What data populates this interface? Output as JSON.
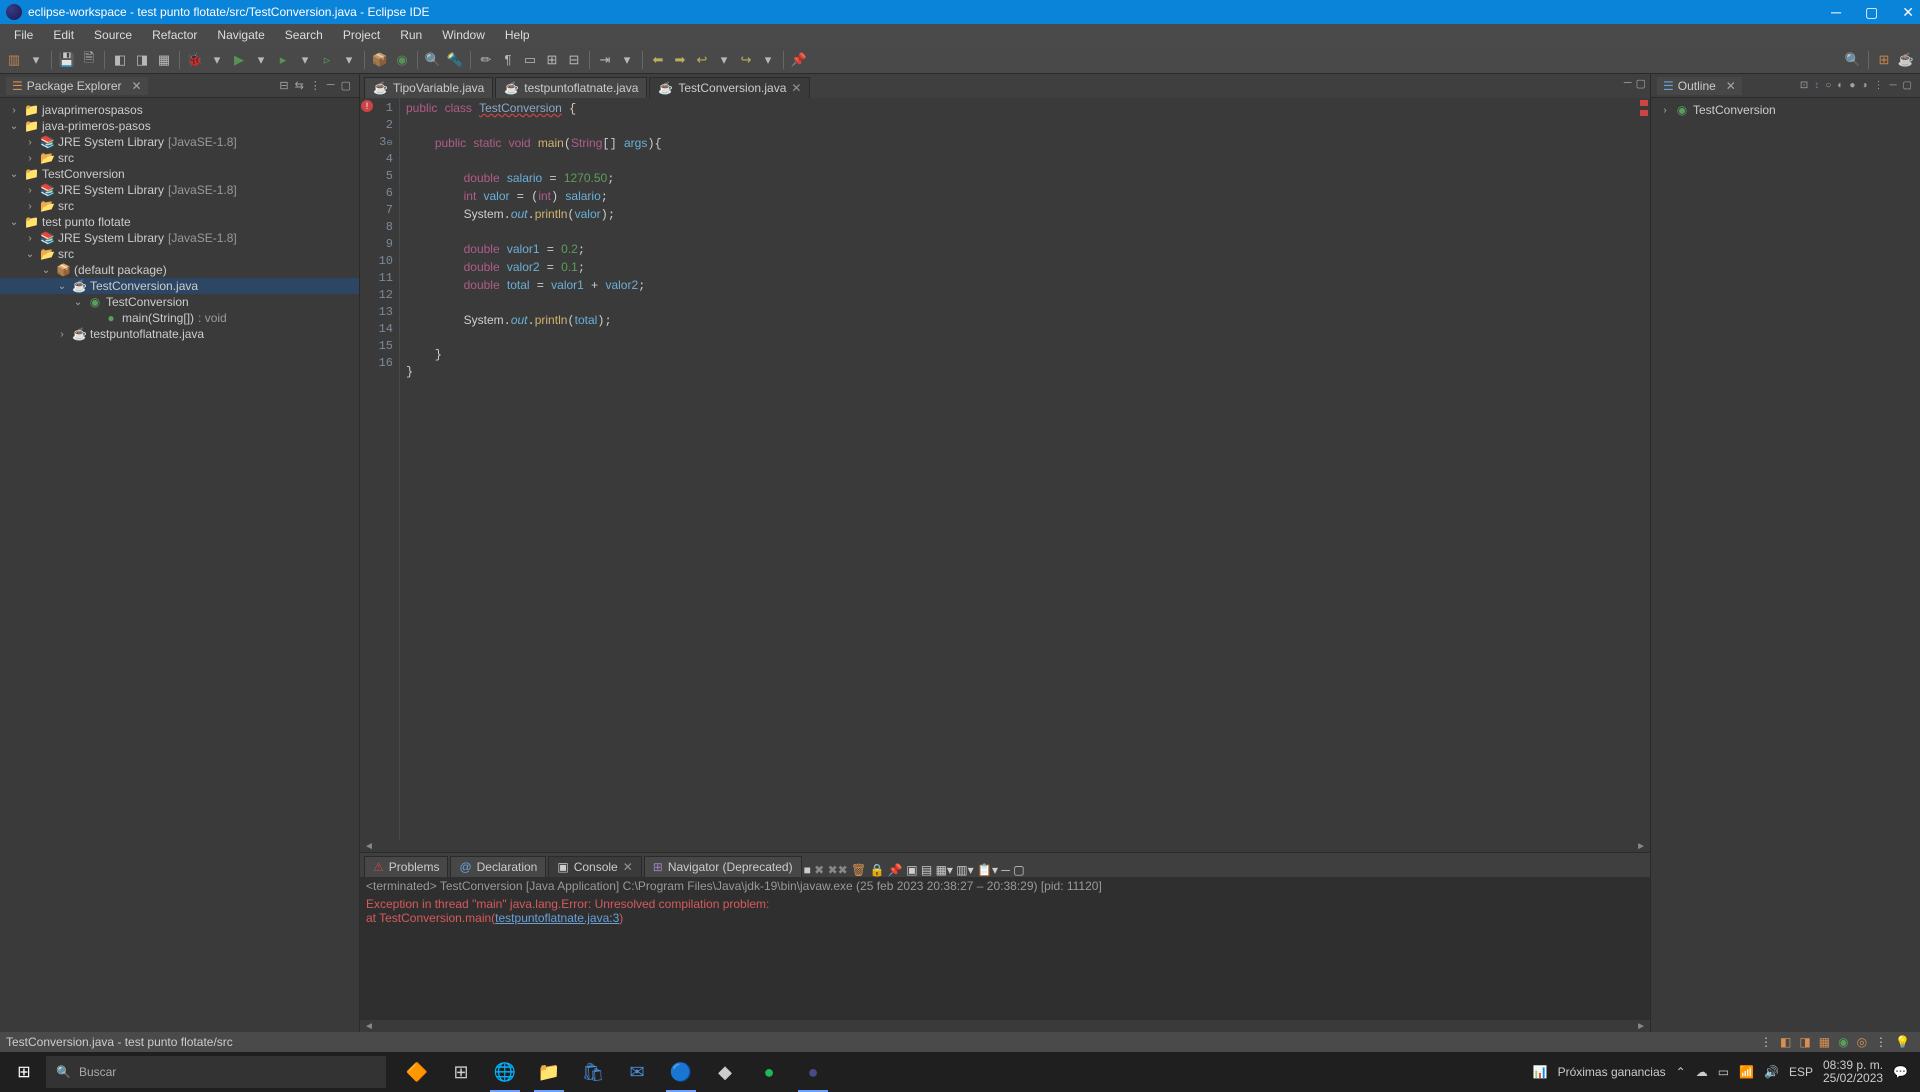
{
  "title": "eclipse-workspace - test punto flotate/src/TestConversion.java - Eclipse IDE",
  "menu": {
    "file": "File",
    "edit": "Edit",
    "source": "Source",
    "refactor": "Refactor",
    "navigate": "Navigate",
    "search": "Search",
    "project": "Project",
    "run": "Run",
    "window": "Window",
    "help": "Help"
  },
  "pkgExplorer": {
    "title": "Package Explorer",
    "projects": {
      "p1": "javaprimerospasos",
      "p2": "java-primeros-pasos",
      "p2_lib": "JRE System Library",
      "lib_ver": "[JavaSE-1.8]",
      "src": "src",
      "p3": "TestConversion",
      "p4": "test punto flotate",
      "defpkg": "(default package)",
      "file1": "TestConversion.java",
      "cls1": "TestConversion",
      "m1": "main(String[])",
      "m1t": " : void",
      "file2": "testpuntoflatnate.java"
    }
  },
  "editor": {
    "tabs": {
      "t1": "TipoVariable.java",
      "t2": "testpuntoflatnate.java",
      "t3": "TestConversion.java"
    },
    "lines": [
      "1",
      "2",
      "3",
      "4",
      "5",
      "6",
      "7",
      "8",
      "9",
      "10",
      "11",
      "12",
      "13",
      "14",
      "15",
      "16"
    ]
  },
  "outline": {
    "title": "Outline",
    "root": "TestConversion"
  },
  "bottom": {
    "problems": "Problems",
    "declaration": "Declaration",
    "console": "Console",
    "navigator": "Navigator (Deprecated)",
    "info": "<terminated> TestConversion [Java Application] C:\\Program Files\\Java\\jdk-19\\bin\\javaw.exe  (25 feb 2023 20:38:27 – 20:38:29) [pid: 11120]",
    "err1": "Exception in thread \"main\" java.lang.Error: Unresolved compilation problem:",
    "err2_pre": "        at TestConversion.main(",
    "err2_link": "testpuntoflatnate.java:3",
    "err2_post": ")"
  },
  "status": {
    "path": "TestConversion.java - test punto flotate/src"
  },
  "taskbar": {
    "search_ph": "Buscar",
    "weather": "Próximas ganancias",
    "lang": "ESP",
    "time": "08:39 p. m.",
    "date": "25/02/2023"
  }
}
